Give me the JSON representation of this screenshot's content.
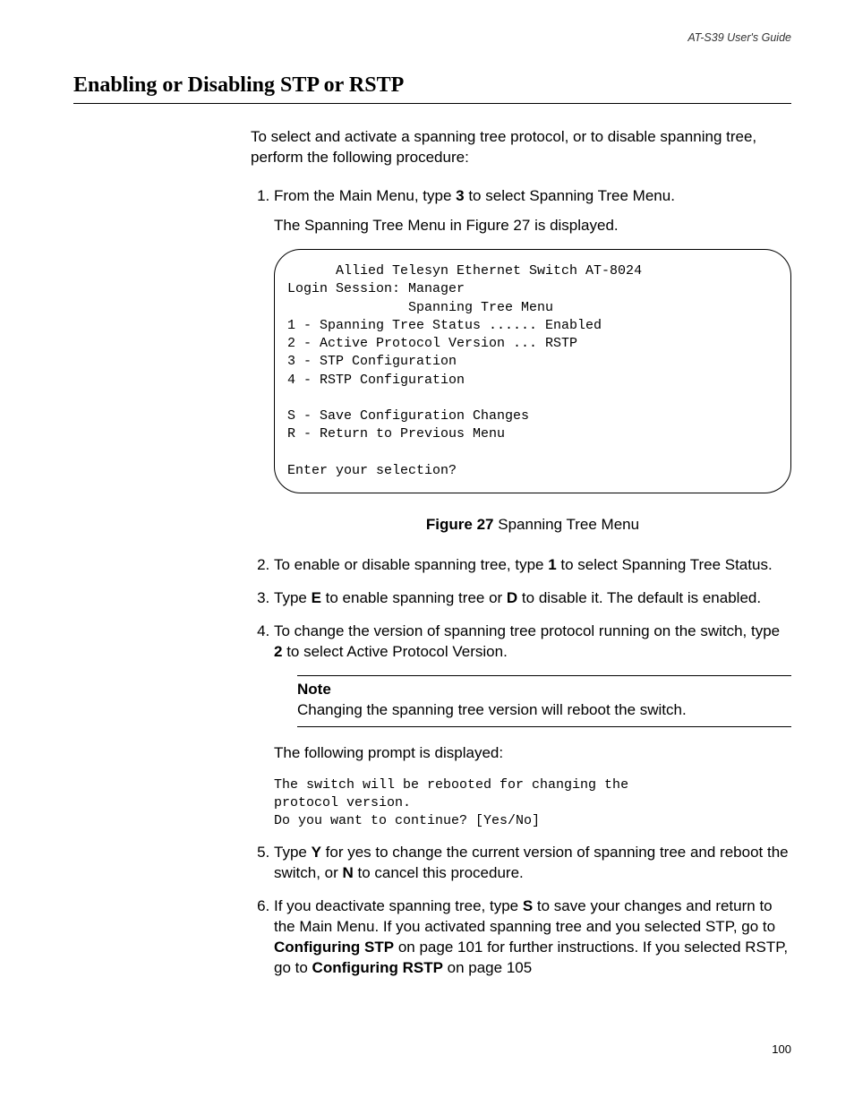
{
  "header": {
    "doc_title": "AT-S39 User's Guide"
  },
  "title": "Enabling or Disabling STP or RSTP",
  "intro": "To select and activate a spanning tree protocol, or to disable spanning tree, perform the following procedure:",
  "steps": {
    "s1_a": "From the Main Menu, type ",
    "s1_b": "3",
    "s1_c": " to select Spanning Tree Menu.",
    "s1_sub": "The Spanning Tree Menu in Figure 27 is displayed.",
    "s2_a": "To enable or disable spanning tree, type ",
    "s2_b": "1",
    "s2_c": " to select Spanning Tree Status.",
    "s3_a": "Type ",
    "s3_b": "E",
    "s3_c": " to enable spanning tree or ",
    "s3_d": "D",
    "s3_e": " to disable it. The default is enabled.",
    "s4_a": "To change the version of spanning tree protocol running on the switch, type ",
    "s4_b": "2",
    "s4_c": " to select Active Protocol Version.",
    "s4_after": "The following prompt is displayed:",
    "s5_a": "Type ",
    "s5_b": "Y",
    "s5_c": " for yes to change the current version of spanning tree and reboot the switch, or ",
    "s5_d": "N",
    "s5_e": " to cancel this procedure.",
    "s6_a": "If you deactivate spanning tree, type ",
    "s6_b": "S",
    "s6_c": " to save your changes and return to the Main Menu. If you activated spanning tree and you selected STP, go to ",
    "s6_d": "Configuring STP",
    "s6_e": " on page 101 for further instructions. If you selected RSTP, go to ",
    "s6_f": "Configuring RSTP",
    "s6_g": " on page 105"
  },
  "terminal": "      Allied Telesyn Ethernet Switch AT-8024\nLogin Session: Manager\n               Spanning Tree Menu\n1 - Spanning Tree Status ...... Enabled\n2 - Active Protocol Version ... RSTP\n3 - STP Configuration\n4 - RSTP Configuration\n\nS - Save Configuration Changes\nR - Return to Previous Menu\n\nEnter your selection?",
  "figure": {
    "label": "Figure 27",
    "caption": "  Spanning Tree Menu"
  },
  "note": {
    "title": "Note",
    "body": "Changing the spanning tree version will reboot the switch."
  },
  "prompt": "The switch will be rebooted for changing the\nprotocol version.\nDo you want to continue? [Yes/No]",
  "page_number": "100"
}
